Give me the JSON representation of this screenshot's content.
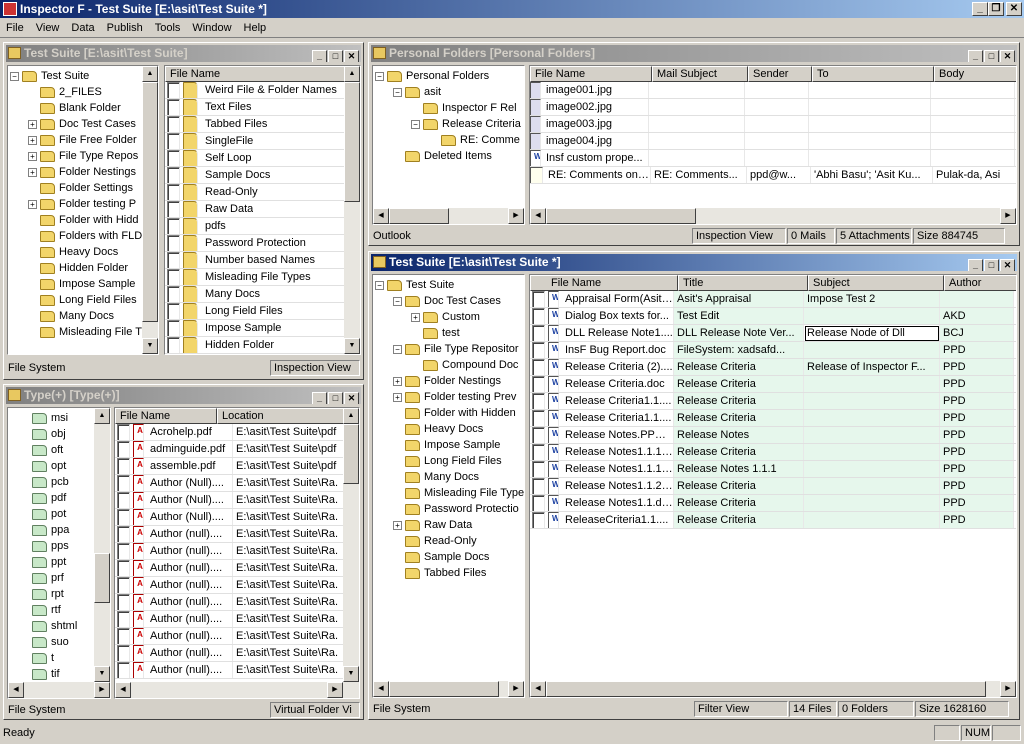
{
  "app": {
    "title": "Inspector F - Test Suite [E:\\asit\\Test Suite *]"
  },
  "menu": [
    "File",
    "View",
    "Data",
    "Publish",
    "Tools",
    "Window",
    "Help"
  ],
  "pane1": {
    "title": "Test Suite [E:\\asit\\Test Suite]",
    "tree": [
      {
        "label": "Test Suite",
        "exp": "⊟",
        "lvl": 0
      },
      {
        "label": "2_FILES",
        "exp": "",
        "lvl": 1
      },
      {
        "label": "Blank Folder",
        "exp": "",
        "lvl": 1
      },
      {
        "label": "Doc Test Cases",
        "exp": "+",
        "lvl": 1
      },
      {
        "label": "File Free Folder",
        "exp": "+",
        "lvl": 1
      },
      {
        "label": "File Type Repos",
        "exp": "+",
        "lvl": 1
      },
      {
        "label": "Folder Nestings",
        "exp": "+",
        "lvl": 1
      },
      {
        "label": "Folder Settings",
        "exp": "",
        "lvl": 1
      },
      {
        "label": "Folder testing P",
        "exp": "+",
        "lvl": 1
      },
      {
        "label": "Folder with Hidd",
        "exp": "",
        "lvl": 1
      },
      {
        "label": "Folders with FLD",
        "exp": "",
        "lvl": 1
      },
      {
        "label": "Heavy Docs",
        "exp": "",
        "lvl": 1
      },
      {
        "label": "Hidden Folder",
        "exp": "",
        "lvl": 1
      },
      {
        "label": "Impose Sample",
        "exp": "",
        "lvl": 1
      },
      {
        "label": "Long Field Files",
        "exp": "",
        "lvl": 1
      },
      {
        "label": "Many Docs",
        "exp": "",
        "lvl": 1
      },
      {
        "label": "Misleading File T",
        "exp": "",
        "lvl": 1
      }
    ],
    "list_header": "File Name",
    "files": [
      "Weird File & Folder Names",
      "Text Files",
      "Tabbed Files",
      "SingleFile",
      "Self Loop",
      "Sample Docs",
      "Read-Only",
      "Raw Data",
      "pdfs",
      "Password Protection",
      "Number based Names",
      "Misleading File Types",
      "Many Docs",
      "Long Field Files",
      "Impose Sample",
      "Hidden Folder"
    ],
    "status_left": "File System",
    "status_right": "Inspection View"
  },
  "pane2": {
    "title": "Type(+) [Type(+)]",
    "tree": [
      "msi",
      "obj",
      "oft",
      "opt",
      "pcb",
      "pdf",
      "pot",
      "ppa",
      "pps",
      "ppt",
      "prf",
      "rpt",
      "rtf",
      "shtml",
      "suo",
      "t",
      "tif"
    ],
    "headers": [
      "File Name",
      "Location"
    ],
    "rows": [
      [
        "Acrohelp.pdf",
        "E:\\asit\\Test Suite\\pdf"
      ],
      [
        "adminguide.pdf",
        "E:\\asit\\Test Suite\\pdf"
      ],
      [
        "assemble.pdf",
        "E:\\asit\\Test Suite\\pdf"
      ],
      [
        "Author (Null)....",
        "E:\\asit\\Test Suite\\Ra."
      ],
      [
        "Author (Null)....",
        "E:\\asit\\Test Suite\\Ra."
      ],
      [
        "Author (Null)....",
        "E:\\asit\\Test Suite\\Ra."
      ],
      [
        "Author (null)....",
        "E:\\asit\\Test Suite\\Ra."
      ],
      [
        "Author (null)....",
        "E:\\asit\\Test Suite\\Ra."
      ],
      [
        "Author (null)....",
        "E:\\asit\\Test Suite\\Ra."
      ],
      [
        "Author (null)....",
        "E:\\asit\\Test Suite\\Ra."
      ],
      [
        "Author (null)....",
        "E:\\asit\\Test Suite\\Ra."
      ],
      [
        "Author (null)....",
        "E:\\asit\\Test Suite\\Ra."
      ],
      [
        "Author (null)....",
        "E:\\asit\\Test Suite\\Ra."
      ],
      [
        "Author (null)....",
        "E:\\asit\\Test Suite\\Ra."
      ],
      [
        "Author (null)....",
        "E:\\asit\\Test Suite\\Ra."
      ]
    ],
    "status_left": "File System",
    "status_right": "Virtual Folder Vi"
  },
  "pane3": {
    "title": "Personal Folders [Personal Folders]",
    "tree": [
      {
        "label": "Personal Folders",
        "exp": "⊟",
        "lvl": 0,
        "icon": "fold"
      },
      {
        "label": "asit",
        "exp": "⊟",
        "lvl": 1,
        "icon": "fold"
      },
      {
        "label": "Inspector F Rel",
        "exp": "",
        "lvl": 2,
        "icon": "fold"
      },
      {
        "label": "Release Criteria",
        "exp": "⊟",
        "lvl": 2,
        "icon": "fold"
      },
      {
        "label": "RE: Comme",
        "exp": "",
        "lvl": 3,
        "icon": "fold"
      },
      {
        "label": "Deleted Items",
        "exp": "",
        "lvl": 1,
        "icon": "fold"
      }
    ],
    "headers": [
      "File Name",
      "Mail Subject",
      "Sender",
      "To",
      "Body"
    ],
    "rows": [
      {
        "icon": "img",
        "cells": [
          "image001.jpg",
          "",
          "",
          "",
          ""
        ]
      },
      {
        "icon": "img",
        "cells": [
          "image002.jpg",
          "",
          "",
          "",
          ""
        ]
      },
      {
        "icon": "img",
        "cells": [
          "image003.jpg",
          "",
          "",
          "",
          ""
        ]
      },
      {
        "icon": "img",
        "cells": [
          "image004.jpg",
          "",
          "",
          "",
          ""
        ]
      },
      {
        "icon": "doc",
        "cells": [
          "Insf custom prope...",
          "",
          "",
          "",
          ""
        ]
      },
      {
        "icon": "mail",
        "cells": [
          "RE: Comments on ...",
          "RE: Comments...",
          "ppd@w...",
          "'Abhi Basu'; 'Asit Ku...",
          "Pulak-da,     Asi"
        ]
      }
    ],
    "status_left": "Outlook",
    "s1": "Inspection View",
    "s2": "0 Mails",
    "s3": "5 Attachments",
    "s4": "Size 884745"
  },
  "pane4": {
    "title": "Test Suite [E:\\asit\\Test Suite *]",
    "tree": [
      {
        "label": "Test Suite",
        "exp": "⊟",
        "lvl": 0
      },
      {
        "label": "Doc Test Cases",
        "exp": "⊟",
        "lvl": 1
      },
      {
        "label": "Custom",
        "exp": "+",
        "lvl": 2
      },
      {
        "label": "test",
        "exp": "",
        "lvl": 2
      },
      {
        "label": "File Type Repositor",
        "exp": "⊟",
        "lvl": 1
      },
      {
        "label": "Compound Doc",
        "exp": "",
        "lvl": 2
      },
      {
        "label": "Folder Nestings",
        "exp": "+",
        "lvl": 1
      },
      {
        "label": "Folder testing Prev",
        "exp": "+",
        "lvl": 1
      },
      {
        "label": "Folder with Hidden",
        "exp": "",
        "lvl": 1
      },
      {
        "label": "Heavy Docs",
        "exp": "",
        "lvl": 1
      },
      {
        "label": "Impose Sample",
        "exp": "",
        "lvl": 1
      },
      {
        "label": "Long Field Files",
        "exp": "",
        "lvl": 1
      },
      {
        "label": "Many Docs",
        "exp": "",
        "lvl": 1
      },
      {
        "label": "Misleading File Type",
        "exp": "",
        "lvl": 1
      },
      {
        "label": "Password Protectio",
        "exp": "",
        "lvl": 1
      },
      {
        "label": "Raw Data",
        "exp": "+",
        "lvl": 1
      },
      {
        "label": "Read-Only",
        "exp": "",
        "lvl": 1
      },
      {
        "label": "Sample Docs",
        "exp": "",
        "lvl": 1
      },
      {
        "label": "Tabbed Files",
        "exp": "",
        "lvl": 1
      }
    ],
    "headers": [
      "File Name",
      "Title",
      "Subject",
      "Author"
    ],
    "rows": [
      [
        "Appraisal Form(Asit ...",
        "Asit's Appraisal",
        "Impose Test 2",
        ""
      ],
      [
        "Dialog Box texts for...",
        "Test Edit",
        "",
        "AKD"
      ],
      [
        "DLL Release Note1....",
        "DLL Release Note Ver...",
        "Release Node of Dll",
        "BCJ"
      ],
      [
        "InsF Bug Report.doc",
        "FileSystem:   xadsafd...",
        "",
        "PPD"
      ],
      [
        "Release Criteria (2)....",
        "Release Criteria",
        "Release of Inspector F...",
        "PPD"
      ],
      [
        "Release Criteria.doc",
        "Release Criteria",
        "",
        "PPD"
      ],
      [
        "Release Criteria1.1....",
        "Release Criteria",
        "",
        "PPD"
      ],
      [
        "Release Criteria1.1....",
        "Release Criteria",
        "",
        "PPD"
      ],
      [
        "Release Notes.PPD....",
        "Release Notes",
        "",
        "PPD"
      ],
      [
        "Release Notes1.1.1....",
        "Release Criteria",
        "",
        "PPD"
      ],
      [
        "Release Notes1.1.1....",
        "Release Notes 1.1.1",
        "",
        "PPD"
      ],
      [
        "Release Notes1.1.2....",
        "Release Criteria",
        "",
        "PPD"
      ],
      [
        "Release Notes1.1.doc",
        "Release Criteria",
        "",
        "PPD"
      ],
      [
        "ReleaseCriteria1.1....",
        "Release Criteria",
        "",
        "PPD"
      ]
    ],
    "status_left": "File System",
    "s1": "Filter View",
    "s2": "14 Files",
    "s3": "0 Folders",
    "s4": "Size 1628160"
  },
  "statusbar": {
    "ready": "Ready",
    "num": "NUM"
  }
}
